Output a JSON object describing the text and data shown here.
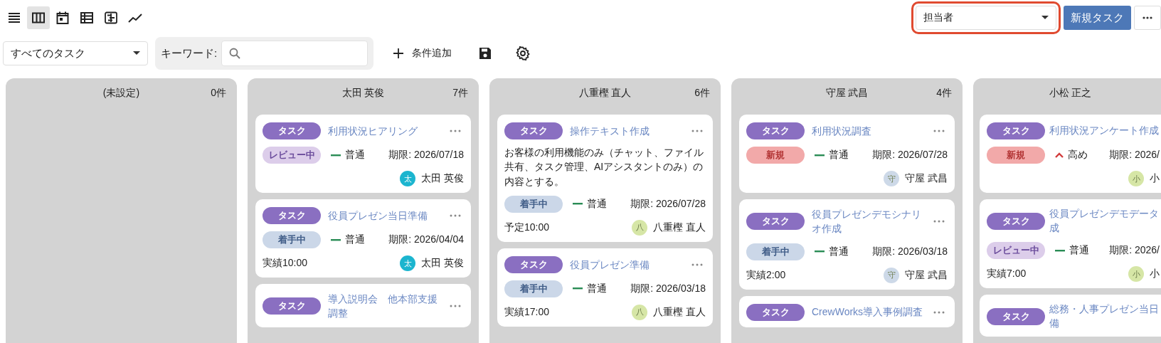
{
  "toolbar": {
    "views": [
      {
        "kind": "list",
        "selected": false
      },
      {
        "kind": "board",
        "selected": true
      },
      {
        "kind": "calendar",
        "selected": false
      },
      {
        "kind": "table",
        "selected": false
      },
      {
        "kind": "timeline",
        "selected": false
      },
      {
        "kind": "chart",
        "selected": false
      }
    ]
  },
  "group_by": {
    "value": "担当者",
    "highlighted": true
  },
  "new_task_button": "新規タスク",
  "filter": {
    "preset": "すべてのタスク",
    "keyword_label": "キーワード:",
    "add_condition": "条件追加"
  },
  "columns": [
    {
      "title": "(未設定)",
      "count": "0件"
    },
    {
      "title": "太田 英俊",
      "count": "7件",
      "cards": [
        {
          "type": "タスク",
          "title": "利用状況ヒアリング",
          "menu": true,
          "status": {
            "label": "レビュー中",
            "kind": "review"
          },
          "priority": {
            "label": "普通",
            "kind": "normal"
          },
          "due": "期限: 2026/07/18",
          "assignee": {
            "initial": "太",
            "name": "太田 英俊",
            "color": "#1cb5cf"
          }
        },
        {
          "type": "タスク",
          "title": "役員プレゼン当日準備",
          "menu": true,
          "status": {
            "label": "着手中",
            "kind": "in_progress"
          },
          "priority": {
            "label": "普通",
            "kind": "normal"
          },
          "due": "期限: 2026/04/04",
          "time": "実績10:00",
          "assignee": {
            "initial": "太",
            "name": "太田 英俊",
            "color": "#1cb5cf"
          }
        },
        {
          "type": "タスク",
          "title": "導入説明会　他本部支援調整",
          "menu": true
        }
      ]
    },
    {
      "title": "八重樫 直人",
      "count": "6件",
      "cards": [
        {
          "type": "タスク",
          "title": "操作テキスト作成",
          "menu": true,
          "description": "お客様の利用機能のみ（チャット、ファイル共有、タスク管理、AIアシスタントのみ）の内容とする。",
          "status": {
            "label": "着手中",
            "kind": "in_progress"
          },
          "priority": {
            "label": "普通",
            "kind": "normal"
          },
          "due": "期限: 2026/07/28",
          "time": "予定10:00",
          "assignee": {
            "initial": "八",
            "name": "八重樫 直人",
            "color": "#d6e6a6"
          }
        },
        {
          "type": "タスク",
          "title": "役員プレゼン準備",
          "menu": true,
          "status": {
            "label": "着手中",
            "kind": "in_progress"
          },
          "priority": {
            "label": "普通",
            "kind": "normal"
          },
          "due": "期限: 2026/03/18",
          "time": "実績17:00",
          "assignee": {
            "initial": "八",
            "name": "八重樫 直人",
            "color": "#d6e6a6"
          }
        }
      ]
    },
    {
      "title": "守屋 武昌",
      "count": "4件",
      "cards": [
        {
          "type": "タスク",
          "title": "利用状況調査",
          "menu": true,
          "status": {
            "label": "新規",
            "kind": "new"
          },
          "priority": {
            "label": "普通",
            "kind": "normal"
          },
          "due": "期限: 2026/07/28",
          "assignee": {
            "initial": "守",
            "name": "守屋 武昌",
            "color": "#cdd9e8"
          }
        },
        {
          "type": "タスク",
          "title": "役員プレゼンデモシナリオ作成",
          "menu": true,
          "status": {
            "label": "着手中",
            "kind": "in_progress"
          },
          "priority": {
            "label": "普通",
            "kind": "normal"
          },
          "due": "期限: 2026/03/18",
          "time": "実績2:00",
          "assignee": {
            "initial": "守",
            "name": "守屋 武昌",
            "color": "#cdd9e8"
          }
        },
        {
          "type": "タスク",
          "title": "CrewWorks導入事例調査",
          "menu": true
        }
      ]
    },
    {
      "title": "小松 正之",
      "cards": [
        {
          "type": "タスク",
          "title": "利用状況アンケート作成",
          "menu": false,
          "status": {
            "label": "新規",
            "kind": "new"
          },
          "priority": {
            "label": "高め",
            "kind": "high"
          },
          "due": "期限: 2026/",
          "assignee": {
            "initial": "小",
            "name": "小",
            "color": "#d6e6a6"
          }
        },
        {
          "type": "タスク",
          "title": "役員プレゼンデモデータ成",
          "menu": false,
          "status": {
            "label": "レビュー中",
            "kind": "review"
          },
          "priority": {
            "label": "普通",
            "kind": "normal"
          },
          "due": "期限: 2026/",
          "time": "実績7:00",
          "assignee": {
            "initial": "小",
            "name": "小",
            "color": "#d6e6a6"
          }
        },
        {
          "type": "タスク",
          "title": "総務・人事プレゼン当日備",
          "menu": false
        }
      ]
    }
  ]
}
